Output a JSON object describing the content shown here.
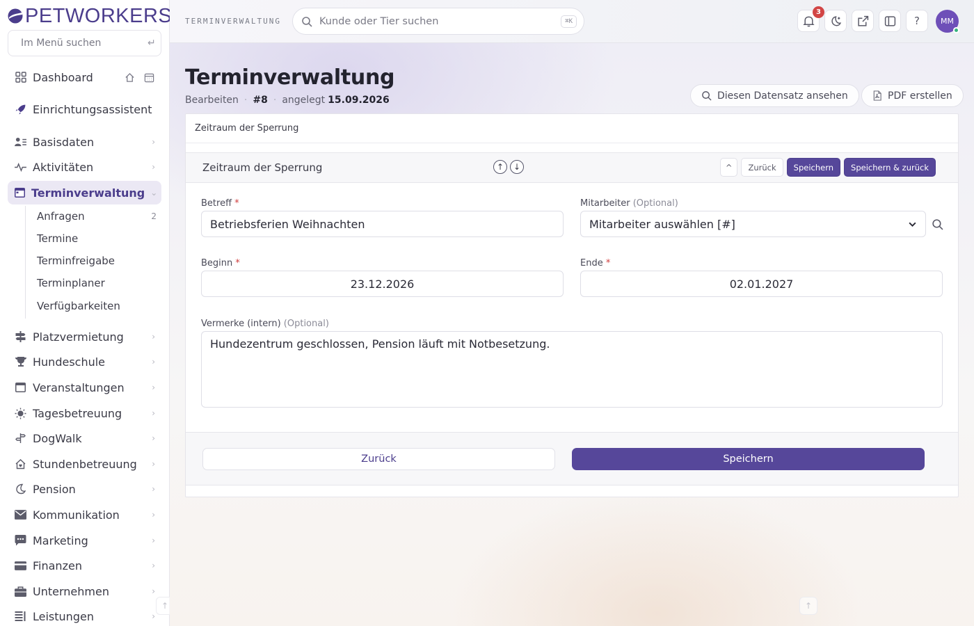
{
  "brand": {
    "name": "PETWORKERS",
    "accent": "#56479a"
  },
  "sidebar": {
    "search_placeholder": "Im Menü suchen",
    "dashboard": "Dashboard",
    "setup": "Einrichtungsassistent",
    "items": [
      {
        "label": "Basisdaten",
        "icon": "users-list-icon"
      },
      {
        "label": "Aktivitäten",
        "icon": "activity-icon"
      },
      {
        "label": "Terminverwaltung",
        "icon": "calendar-icon"
      },
      {
        "label": "Platzvermietung",
        "icon": "signpost-icon"
      },
      {
        "label": "Hundeschule",
        "icon": "trophy-icon"
      },
      {
        "label": "Veranstaltungen",
        "icon": "calendar-event-icon"
      },
      {
        "label": "Tagesbetreuung",
        "icon": "sun-icon"
      },
      {
        "label": "DogWalk",
        "icon": "walk-icon"
      },
      {
        "label": "Stundenbetreuung",
        "icon": "house-heart-icon"
      },
      {
        "label": "Pension",
        "icon": "moon-icon"
      },
      {
        "label": "Kommunikation",
        "icon": "envelope-icon"
      },
      {
        "label": "Marketing",
        "icon": "chat-icon"
      },
      {
        "label": "Finanzen",
        "icon": "credit-card-icon"
      },
      {
        "label": "Unternehmen",
        "icon": "briefcase-icon"
      },
      {
        "label": "Leistungen",
        "icon": "list-icon"
      }
    ],
    "sub_items": [
      {
        "label": "Anfragen",
        "count": "2"
      },
      {
        "label": "Termine",
        "count": ""
      },
      {
        "label": "Terminfreigabe",
        "count": ""
      },
      {
        "label": "Terminplaner",
        "count": ""
      },
      {
        "label": "Verfügbarkeiten",
        "count": ""
      }
    ]
  },
  "topbar": {
    "crumb": "TERMINVERWALTUNG",
    "search_placeholder": "Kunde oder Tier suchen",
    "shortcut": "⌘K",
    "notifications": "3",
    "avatar": "MM"
  },
  "page": {
    "title": "Terminverwaltung",
    "mode": "Bearbeiten",
    "record_id": "#8",
    "created_label": "angelegt",
    "created_date": "15.09.2026",
    "view_record": "Diesen Datensatz ansehen",
    "create_pdf": "PDF erstellen"
  },
  "form": {
    "card_title": "Zeitraum der Sperrung",
    "section_title": "Zeitraum der Sperrung",
    "actions": {
      "collapse": "^",
      "back": "Zurück",
      "save": "Speichern",
      "save_back": "Speichern & zurück"
    },
    "betreff": {
      "label": "Betreff",
      "value": "Betriebsferien Weihnachten"
    },
    "mitarbeiter": {
      "label": "Mitarbeiter",
      "optional": "(Optional)",
      "value": "Mitarbeiter auswählen [#]"
    },
    "beginn": {
      "label": "Beginn",
      "value": "23.12.2026"
    },
    "ende": {
      "label": "Ende",
      "value": "02.01.2027"
    },
    "vermerke": {
      "label": "Vermerke (intern)",
      "optional": "(Optional)",
      "value": "Hundezentrum geschlossen, Pension läuft mit Notbesetzung."
    },
    "footer_back": "Zurück",
    "footer_save": "Speichern"
  }
}
